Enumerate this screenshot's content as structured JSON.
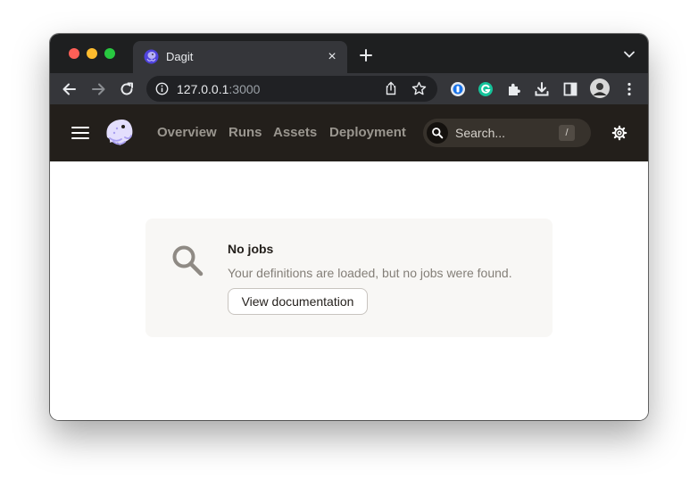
{
  "browser": {
    "tab": {
      "title": "Dagit",
      "favicon": "dagster-logo-icon",
      "close_glyph": "×"
    },
    "address_bar": {
      "host": "127.0.0.1",
      "port": ":3000"
    },
    "icons": [
      "back-arrow-icon",
      "forward-arrow-icon",
      "reload-icon",
      "info-icon",
      "share-icon",
      "star-icon",
      "password-extension-icon",
      "grammarly-extension-icon",
      "puzzle-extensions-icon",
      "download-icon",
      "side-panel-icon",
      "profile-avatar",
      "more-menu-icon"
    ]
  },
  "app_header": {
    "nav": [
      {
        "label": "Overview"
      },
      {
        "label": "Runs"
      },
      {
        "label": "Assets"
      },
      {
        "label": "Deployment"
      }
    ],
    "search": {
      "placeholder": "Search...",
      "shortcut": "/"
    }
  },
  "empty_state": {
    "title": "No jobs",
    "description": "Your definitions are loaded, but no jobs were found.",
    "button_label": "View documentation"
  },
  "colors": {
    "header_bg": "#231f1b",
    "nav_text": "#9a968f",
    "card_bg": "#f8f7f5",
    "browser_dark": "#1e1f20",
    "toolbar": "#35363a"
  }
}
